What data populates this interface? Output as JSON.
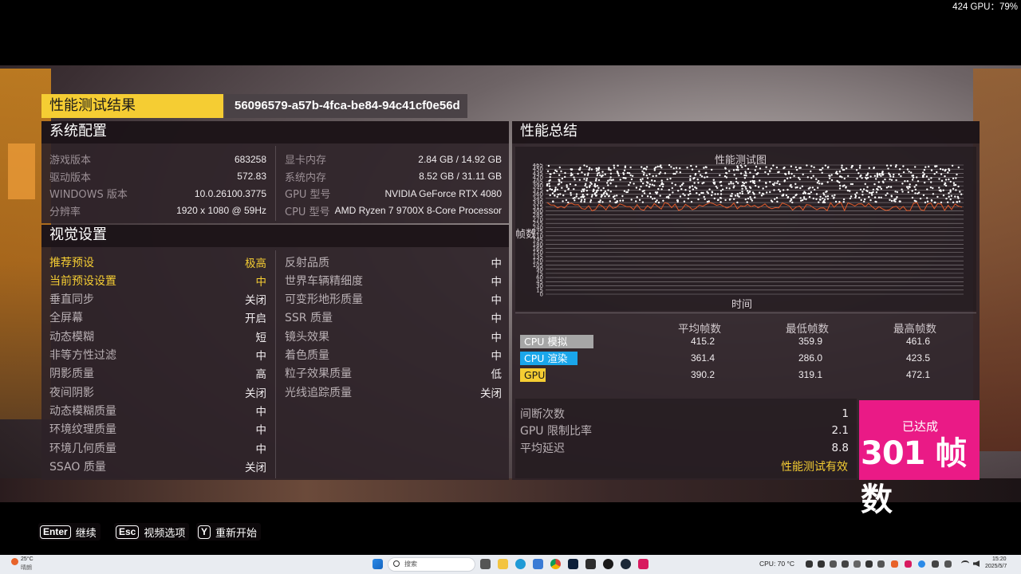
{
  "overlay": {
    "fps_text": "424 GPU：79%"
  },
  "header": {
    "title": "性能测试结果",
    "run_id": "56096579-a57b-4fca-be84-94c41cf0e56d"
  },
  "system": {
    "heading": "系统配置",
    "left": [
      {
        "label": "游戏版本",
        "value": "683258"
      },
      {
        "label": "驱动版本",
        "value": "572.83"
      },
      {
        "label": "WINDOWS 版本",
        "value": "10.0.26100.3775"
      },
      {
        "label": "分辨率",
        "value": "1920 x 1080 @ 59Hz"
      }
    ],
    "right": [
      {
        "label": "显卡内存",
        "value": "2.84 GB / 14.92 GB"
      },
      {
        "label": "系统内存",
        "value": "8.52 GB / 31.11 GB"
      },
      {
        "label": "GPU 型号",
        "value": "NVIDIA GeForce RTX 4080"
      },
      {
        "label": "CPU 型号",
        "value": "AMD Ryzen 7 9700X 8-Core Processor"
      }
    ]
  },
  "visual": {
    "heading": "视觉设置",
    "left": [
      {
        "label": "推荐预设",
        "value": "极高"
      },
      {
        "label": "当前预设设置",
        "value": "中"
      },
      {
        "label": "垂直同步",
        "value": "关闭"
      },
      {
        "label": "全屏幕",
        "value": "开启"
      },
      {
        "label": "动态模糊",
        "value": "短"
      },
      {
        "label": "非等方性过滤",
        "value": "中"
      },
      {
        "label": "阴影质量",
        "value": "高"
      },
      {
        "label": "夜间阴影",
        "value": "关闭"
      },
      {
        "label": "动态模糊质量",
        "value": "中"
      },
      {
        "label": "环境纹理质量",
        "value": "中"
      },
      {
        "label": "环境几何质量",
        "value": "中"
      },
      {
        "label": "SSAO 质量",
        "value": "关闭"
      }
    ],
    "right": [
      {
        "label": "反射品质",
        "value": "中"
      },
      {
        "label": "世界车辆精细度",
        "value": "中"
      },
      {
        "label": "可变形地形质量",
        "value": "中"
      },
      {
        "label": "SSR 质量",
        "value": "中"
      },
      {
        "label": "镜头效果",
        "value": "中"
      },
      {
        "label": "着色质量",
        "value": "中"
      },
      {
        "label": "粒子效果质量",
        "value": "低"
      },
      {
        "label": "光线追踪质量",
        "value": "关闭"
      }
    ]
  },
  "summary": {
    "heading": "性能总结",
    "columns": [
      "平均帧数",
      "最低帧数",
      "最高帧数"
    ],
    "rows": [
      {
        "name": "CPU 模拟",
        "color": "#a6a6a6",
        "text_color": "#ffffff",
        "values": [
          "415.2",
          "359.9",
          "461.6"
        ]
      },
      {
        "name": "CPU 渲染",
        "color": "#1aa6ea",
        "text_color": "#ffffff",
        "values": [
          "361.4",
          "286.0",
          "423.5"
        ]
      },
      {
        "name": "GPU",
        "color": "#f5cd33",
        "text_color": "#1a1a1a",
        "values": [
          "390.2",
          "319.1",
          "472.1"
        ]
      }
    ],
    "extra": [
      {
        "label": "间断次数",
        "value": "1"
      },
      {
        "label": "GPU 限制比率",
        "value": "2.1"
      },
      {
        "label": "平均延迟",
        "value": "8.8"
      }
    ],
    "valid_text": "性能测试有效",
    "achieved_label": "已达成",
    "achieved_value": "301 帧数"
  },
  "chart_data": {
    "type": "scatter",
    "title": "性能测试图",
    "xlabel": "时间",
    "ylabel": "帧数",
    "ylim": [
      0,
      465
    ],
    "y_ticks": [
      465,
      450,
      435,
      420,
      405,
      390,
      375,
      360,
      345,
      330,
      315,
      300,
      285,
      270,
      255,
      240,
      225,
      210,
      195,
      180,
      165,
      150,
      135,
      120,
      105,
      90,
      75,
      60,
      45,
      30,
      15,
      0
    ],
    "series": [
      {
        "color": "#ffffff",
        "range": [
          330,
          465
        ]
      },
      {
        "color": "#e05a2a",
        "range": [
          300,
          330
        ]
      }
    ]
  },
  "footer": {
    "buttons": [
      {
        "key": "Enter",
        "label": "继续"
      },
      {
        "key": "Esc",
        "label": "视频选项"
      },
      {
        "key": "Y",
        "label": "重新开始"
      }
    ]
  },
  "taskbar": {
    "weather": "25°C",
    "weather_sub": "晴朗",
    "search_placeholder": "搜索",
    "cpu_temp": "CPU: 70 °C",
    "time": "15:20",
    "date": "2025/5/7"
  }
}
